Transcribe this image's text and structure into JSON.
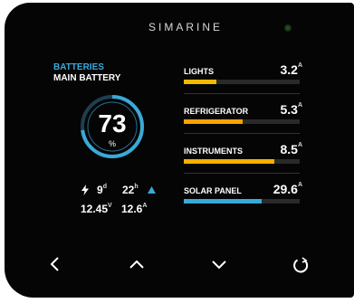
{
  "brand": "SIMARINE",
  "battery": {
    "title": "BATTERIES",
    "name": "MAIN BATTERY",
    "percent": "73",
    "percent_level": 73,
    "unit": "%",
    "days": "9",
    "days_unit": "d",
    "hours": "22",
    "hours_unit": "h",
    "voltage": "12.45",
    "voltage_unit": "V",
    "current": "12.6",
    "current_unit": "A",
    "gauge_color": "#3aa9d8"
  },
  "loads": [
    {
      "label": "LIGHTS",
      "value": "3.2",
      "unit": "A",
      "level": 0.28,
      "color": "#f5b800"
    },
    {
      "label": "REFRIGERATOR",
      "value": "5.3",
      "unit": "A",
      "level": 0.51,
      "color": "#f5a300"
    },
    {
      "label": "INSTRUMENTS",
      "value": "8.5",
      "unit": "A",
      "level": 0.78,
      "color": "#f5b000"
    },
    {
      "label": "SOLAR PANEL",
      "value": "29.6",
      "unit": "A",
      "level": 0.67,
      "color": "#3aa9d8"
    }
  ],
  "icons": {
    "bolt": "bolt-icon",
    "trend": "triangle-up-icon",
    "back": "chevron-left-icon",
    "up": "chevron-up-icon",
    "down": "chevron-down-icon",
    "power": "power-icon"
  }
}
